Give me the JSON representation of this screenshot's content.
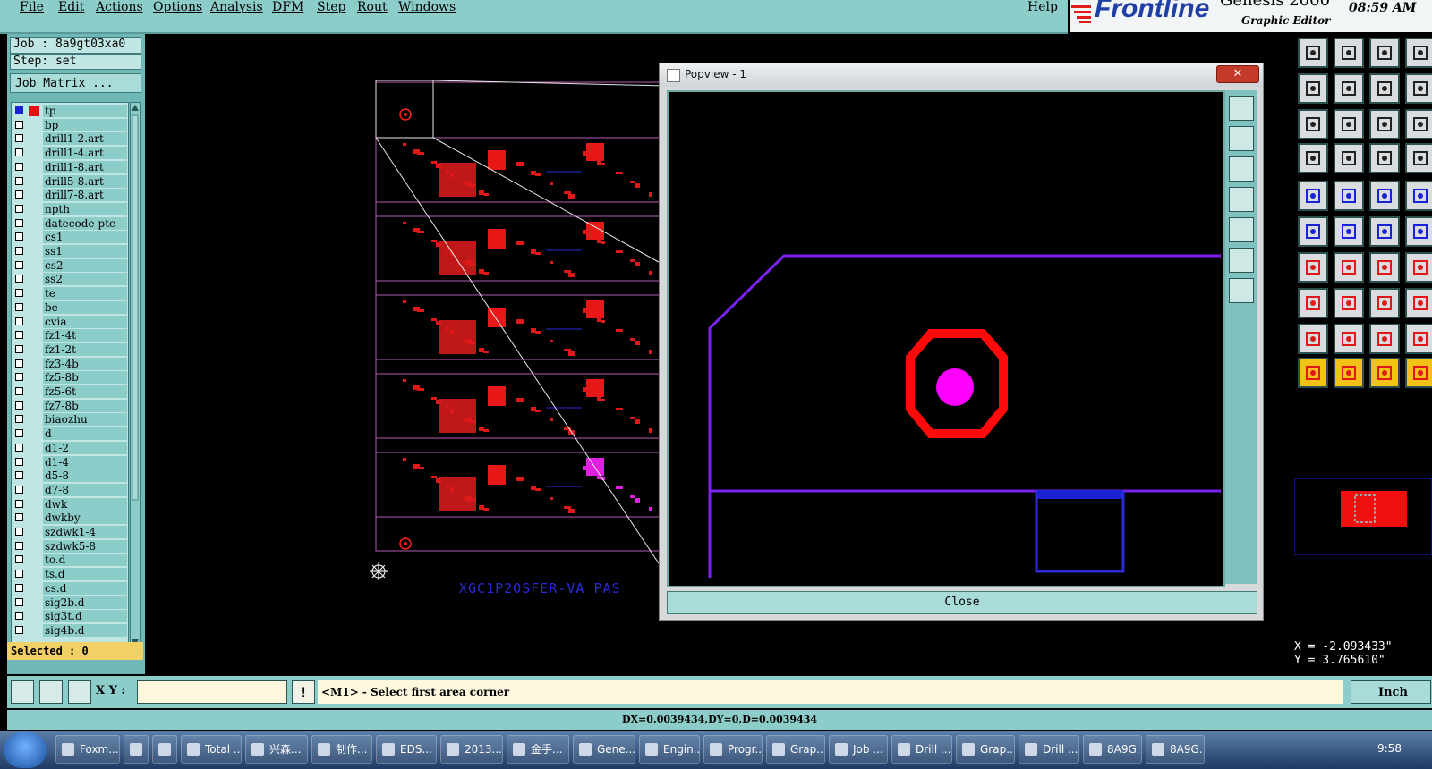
{
  "menubar": {
    "items": [
      "File",
      "Edit",
      "Actions",
      "Options",
      "Analysis",
      "DFM",
      "Step",
      "Rout",
      "Windows"
    ],
    "help": "Help"
  },
  "brand": {
    "logo": "Frontline",
    "product": "Genesis 2000",
    "subtitle": "Graphic Editor",
    "time": "08:59 AM"
  },
  "leftpanel": {
    "job": "Job : 8a9gt03xa0",
    "step": "Step: set",
    "job_matrix": "Job Matrix ...",
    "layers": [
      {
        "name": "tp",
        "checked": true
      },
      {
        "name": "bp",
        "checked": false
      },
      {
        "name": "drill1-2.art",
        "checked": false
      },
      {
        "name": "drill1-4.art",
        "checked": false
      },
      {
        "name": "drill1-8.art",
        "checked": false
      },
      {
        "name": "drill5-8.art",
        "checked": false
      },
      {
        "name": "drill7-8.art",
        "checked": false
      },
      {
        "name": "npth",
        "checked": false
      },
      {
        "name": "datecode-ptc",
        "checked": false
      },
      {
        "name": "cs1",
        "checked": false
      },
      {
        "name": "ss1",
        "checked": false
      },
      {
        "name": "cs2",
        "checked": false
      },
      {
        "name": "ss2",
        "checked": false
      },
      {
        "name": "te",
        "checked": false
      },
      {
        "name": "be",
        "checked": false
      },
      {
        "name": "cvia",
        "checked": false
      },
      {
        "name": "fz1-4t",
        "checked": false
      },
      {
        "name": "fz1-2t",
        "checked": false
      },
      {
        "name": "fz3-4b",
        "checked": false
      },
      {
        "name": "fz5-8b",
        "checked": false
      },
      {
        "name": "fz5-6t",
        "checked": false
      },
      {
        "name": "fz7-8b",
        "checked": false
      },
      {
        "name": "biaozhu",
        "checked": false
      },
      {
        "name": "d",
        "checked": false
      },
      {
        "name": "d1-2",
        "checked": false
      },
      {
        "name": "d1-4",
        "checked": false
      },
      {
        "name": "d5-8",
        "checked": false
      },
      {
        "name": "d7-8",
        "checked": false
      },
      {
        "name": "dwk",
        "checked": false
      },
      {
        "name": "dwkby",
        "checked": false
      },
      {
        "name": "szdwk1-4",
        "checked": false
      },
      {
        "name": "szdwk5-8",
        "checked": false
      },
      {
        "name": "to.d",
        "checked": false
      },
      {
        "name": "ts.d",
        "checked": false
      },
      {
        "name": "cs.d",
        "checked": false
      },
      {
        "name": "sig2b.d",
        "checked": false
      },
      {
        "name": "sig3t.d",
        "checked": false
      },
      {
        "name": "sig4b.d",
        "checked": false
      }
    ],
    "selected": "Selected : 0"
  },
  "canvas": {
    "board_text": "XGC1P2OSFER-VA PAS"
  },
  "popview": {
    "title": "Popview - 1",
    "close_x": "✕",
    "close_button": "Close"
  },
  "coords": {
    "x": "X = -2.093433\"",
    "y": "Y = 3.765610\""
  },
  "cmdbar": {
    "xy_label": "X Y :",
    "xy_value": "",
    "prompt": "<M1> - Select first area corner",
    "unit": "Inch"
  },
  "status": {
    "text": "DX=0.0039434,DY=0,D=0.0039434"
  },
  "taskbar": {
    "items": [
      "Foxm...",
      "",
      "",
      "Total ...",
      "兴森...",
      "制作...",
      "EDS...",
      "2013...",
      "金手...",
      "Gene...",
      "Engin...",
      "Progr...",
      "Grap...",
      "Job ...",
      "Drill ...",
      "Grap...",
      "Drill ...",
      "8A9G...",
      "8A9G..."
    ],
    "time": "9:58"
  },
  "colors": {
    "panel": "#8ccdca",
    "layer_red": "#e61010",
    "outline": "#8a2be2",
    "pad": "#ff00ff"
  }
}
